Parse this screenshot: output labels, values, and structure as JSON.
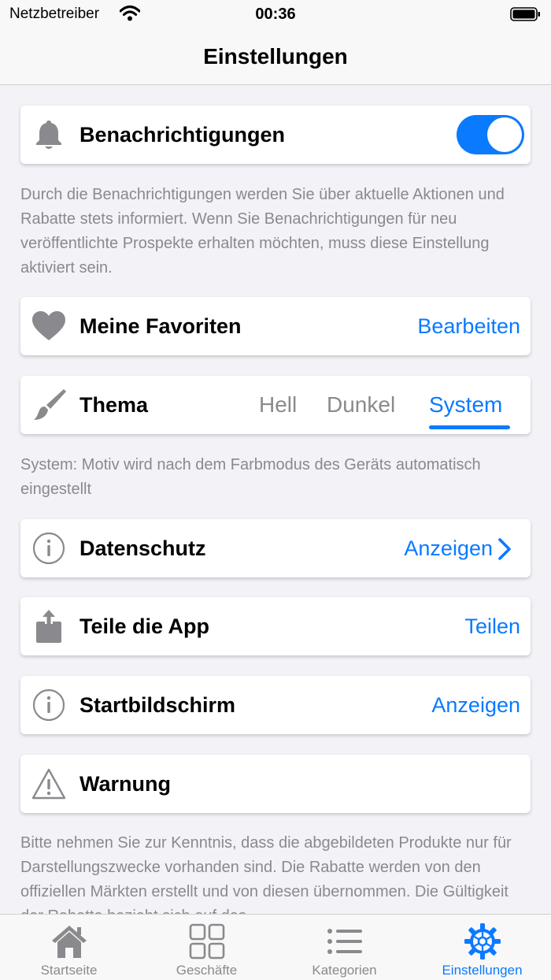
{
  "status": {
    "carrier": "Netzbetreiber",
    "time": "00:36"
  },
  "header": {
    "title": "Einstellungen"
  },
  "notifications": {
    "label": "Benachrichtigungen",
    "enabled": true,
    "description": "Durch die Benachrichtigungen werden Sie über aktuelle Aktionen und Rabatte stets informiert. Wenn Sie Benachrichtigungen für neu veröffentlichte Prospekte erhalten möchten, muss diese Einstellung aktiviert sein."
  },
  "favorites": {
    "label": "Meine Favoriten",
    "action": "Bearbeiten"
  },
  "theme": {
    "label": "Thema",
    "options": [
      "Hell",
      "Dunkel",
      "System"
    ],
    "selected": "System",
    "description": "System: Motiv wird nach dem Farbmodus des Geräts automatisch eingestellt"
  },
  "privacy": {
    "label": "Datenschutz",
    "action": "Anzeigen"
  },
  "share": {
    "label": "Teile die App",
    "action": "Teilen"
  },
  "startscreen": {
    "label": "Startbildschirm",
    "action": "Anzeigen"
  },
  "warning": {
    "label": "Warnung",
    "description": "Bitte nehmen Sie zur Kenntnis, dass die abgebildeten Produkte nur für Darstellungszwecke vorhanden sind. Die Rabatte werden von den offiziellen Märkten erstellt und von diesen übernommen. Die Gültigkeit der Rabatte bezieht sich auf das"
  },
  "tabs": [
    {
      "label": "Startseite",
      "icon": "house-icon"
    },
    {
      "label": "Geschäfte",
      "icon": "grid-icon"
    },
    {
      "label": "Kategorien",
      "icon": "list-icon"
    },
    {
      "label": "Einstellungen",
      "icon": "gear-icon"
    }
  ],
  "colors": {
    "accent": "#0a7aff",
    "secondary_text": "#8a8a8e",
    "background": "#f2f2f7"
  }
}
